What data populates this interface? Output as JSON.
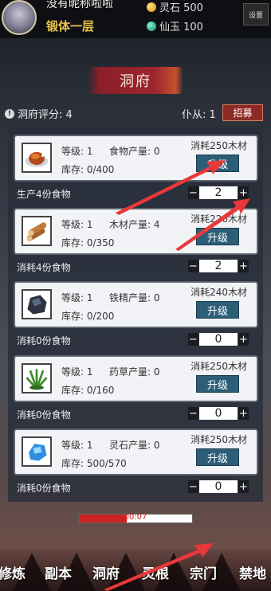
{
  "player": {
    "name": "没有昵称啦啦",
    "realm": "锻体一层"
  },
  "resources": {
    "spirit_stone_label": "灵石 500",
    "jade_label": "仙玉 100"
  },
  "settings_label": "设置",
  "page": {
    "title": "洞府",
    "score_label": "洞府评分: 4",
    "servants_label": "仆从: 1",
    "recruit_label": "招募"
  },
  "buildings": [
    {
      "icon": "roast-chicken-icon",
      "level": "等级: 1",
      "output": "食物产量: 0",
      "stock": "库存: 0/400",
      "cost": "消耗250木材",
      "upgrade": "升级",
      "row_label": "生产4份食物",
      "amount": "2"
    },
    {
      "icon": "wood-logs-icon",
      "level": "等级: 1",
      "output": "木材产量: 4",
      "stock": "库存: 0/350",
      "cost": "消耗220木材",
      "upgrade": "升级",
      "row_label": "消耗4份食物",
      "amount": "2"
    },
    {
      "icon": "iron-ore-icon",
      "level": "等级: 1",
      "output": "铁精产量: 0",
      "stock": "库存: 0/200",
      "cost": "消耗240木材",
      "upgrade": "升级",
      "row_label": "消耗0份食物",
      "amount": "0"
    },
    {
      "icon": "herb-plant-icon",
      "level": "等级: 1",
      "output": "药草产量: 0",
      "stock": "库存: 0/160",
      "cost": "消耗250木材",
      "upgrade": "升级",
      "row_label": "消耗0份食物",
      "amount": "0"
    },
    {
      "icon": "spirit-crystal-icon",
      "level": "等级: 1",
      "output": "灵石产量: 0",
      "stock": "库存: 500/570",
      "cost": "消耗250木材",
      "upgrade": "升级",
      "row_label": "消耗0份食物",
      "amount": "0"
    }
  ],
  "stepper": {
    "minus": "−",
    "plus": "+"
  },
  "timer": {
    "label": "00:07",
    "progress": 0.42
  },
  "nav": [
    "修炼",
    "副本",
    "洞府",
    "灵根",
    "宗门",
    "禁地"
  ],
  "colors": {
    "accent_red": "#8c2b26",
    "button_blue": "#2c5e78",
    "realm_gold": "#e8c24a"
  }
}
